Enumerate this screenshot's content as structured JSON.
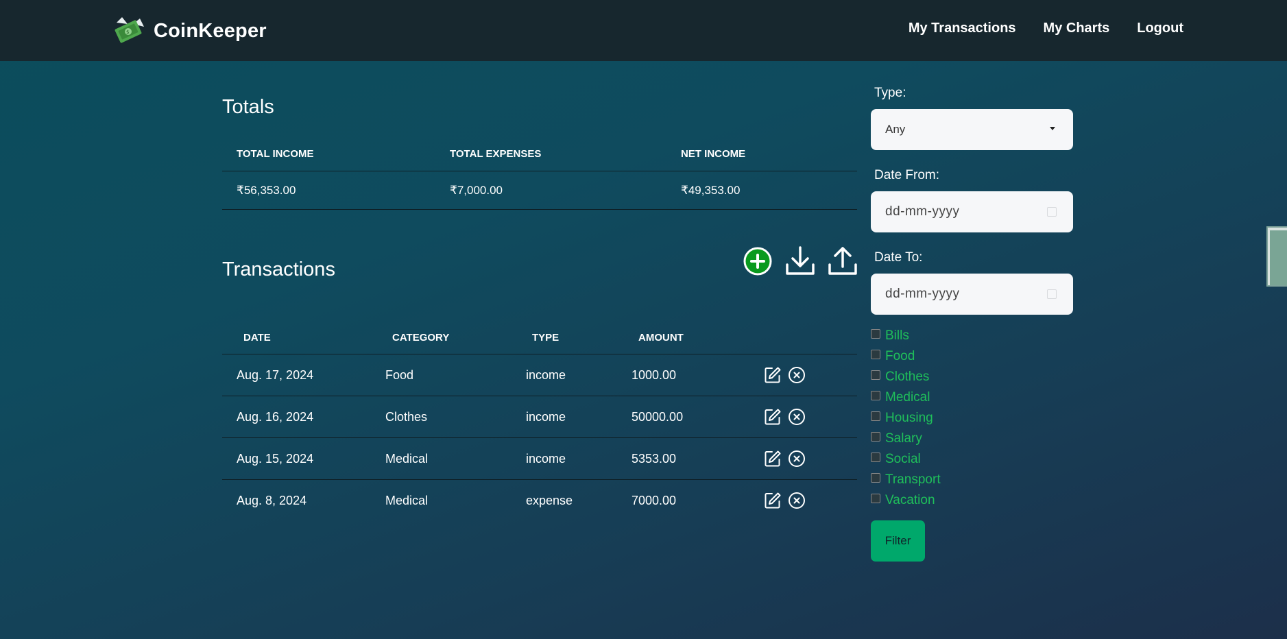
{
  "brand": {
    "name": "CoinKeeper"
  },
  "nav": {
    "links": [
      "My Transactions",
      "My Charts",
      "Logout"
    ]
  },
  "totals": {
    "title": "Totals",
    "headers": [
      "TOTAL INCOME",
      "TOTAL EXPENSES",
      "NET INCOME"
    ],
    "values": [
      "₹56,353.00",
      "₹7,000.00",
      "₹49,353.00"
    ]
  },
  "transactions": {
    "title": "Transactions",
    "headers": [
      "DATE",
      "CATEGORY",
      "TYPE",
      "AMOUNT"
    ],
    "rows": [
      {
        "date": "Aug. 17, 2024",
        "category": "Food",
        "type": "income",
        "amount": "1000.00"
      },
      {
        "date": "Aug. 16, 2024",
        "category": "Clothes",
        "type": "income",
        "amount": "50000.00"
      },
      {
        "date": "Aug. 15, 2024",
        "category": "Medical",
        "type": "income",
        "amount": "5353.00"
      },
      {
        "date": "Aug. 8, 2024",
        "category": "Medical",
        "type": "expense",
        "amount": "7000.00"
      }
    ],
    "actions": [
      "add-icon",
      "download-icon",
      "upload-icon"
    ]
  },
  "filters": {
    "type_label": "Type:",
    "type_value": "Any",
    "date_from_label": "Date From:",
    "date_from_placeholder": "dd-mm-yyyy",
    "date_to_label": "Date To:",
    "date_to_placeholder": "dd-mm-yyyy",
    "categories": [
      "Bills",
      "Food",
      "Clothes",
      "Medical",
      "Housing",
      "Salary",
      "Social",
      "Transport",
      "Vacation"
    ],
    "button_label": "Filter"
  },
  "colors": {
    "navbar": "#17272e",
    "accent_green": "#00a86b",
    "category_text": "#1fbf5a",
    "add_button": "#0a9a1e"
  }
}
